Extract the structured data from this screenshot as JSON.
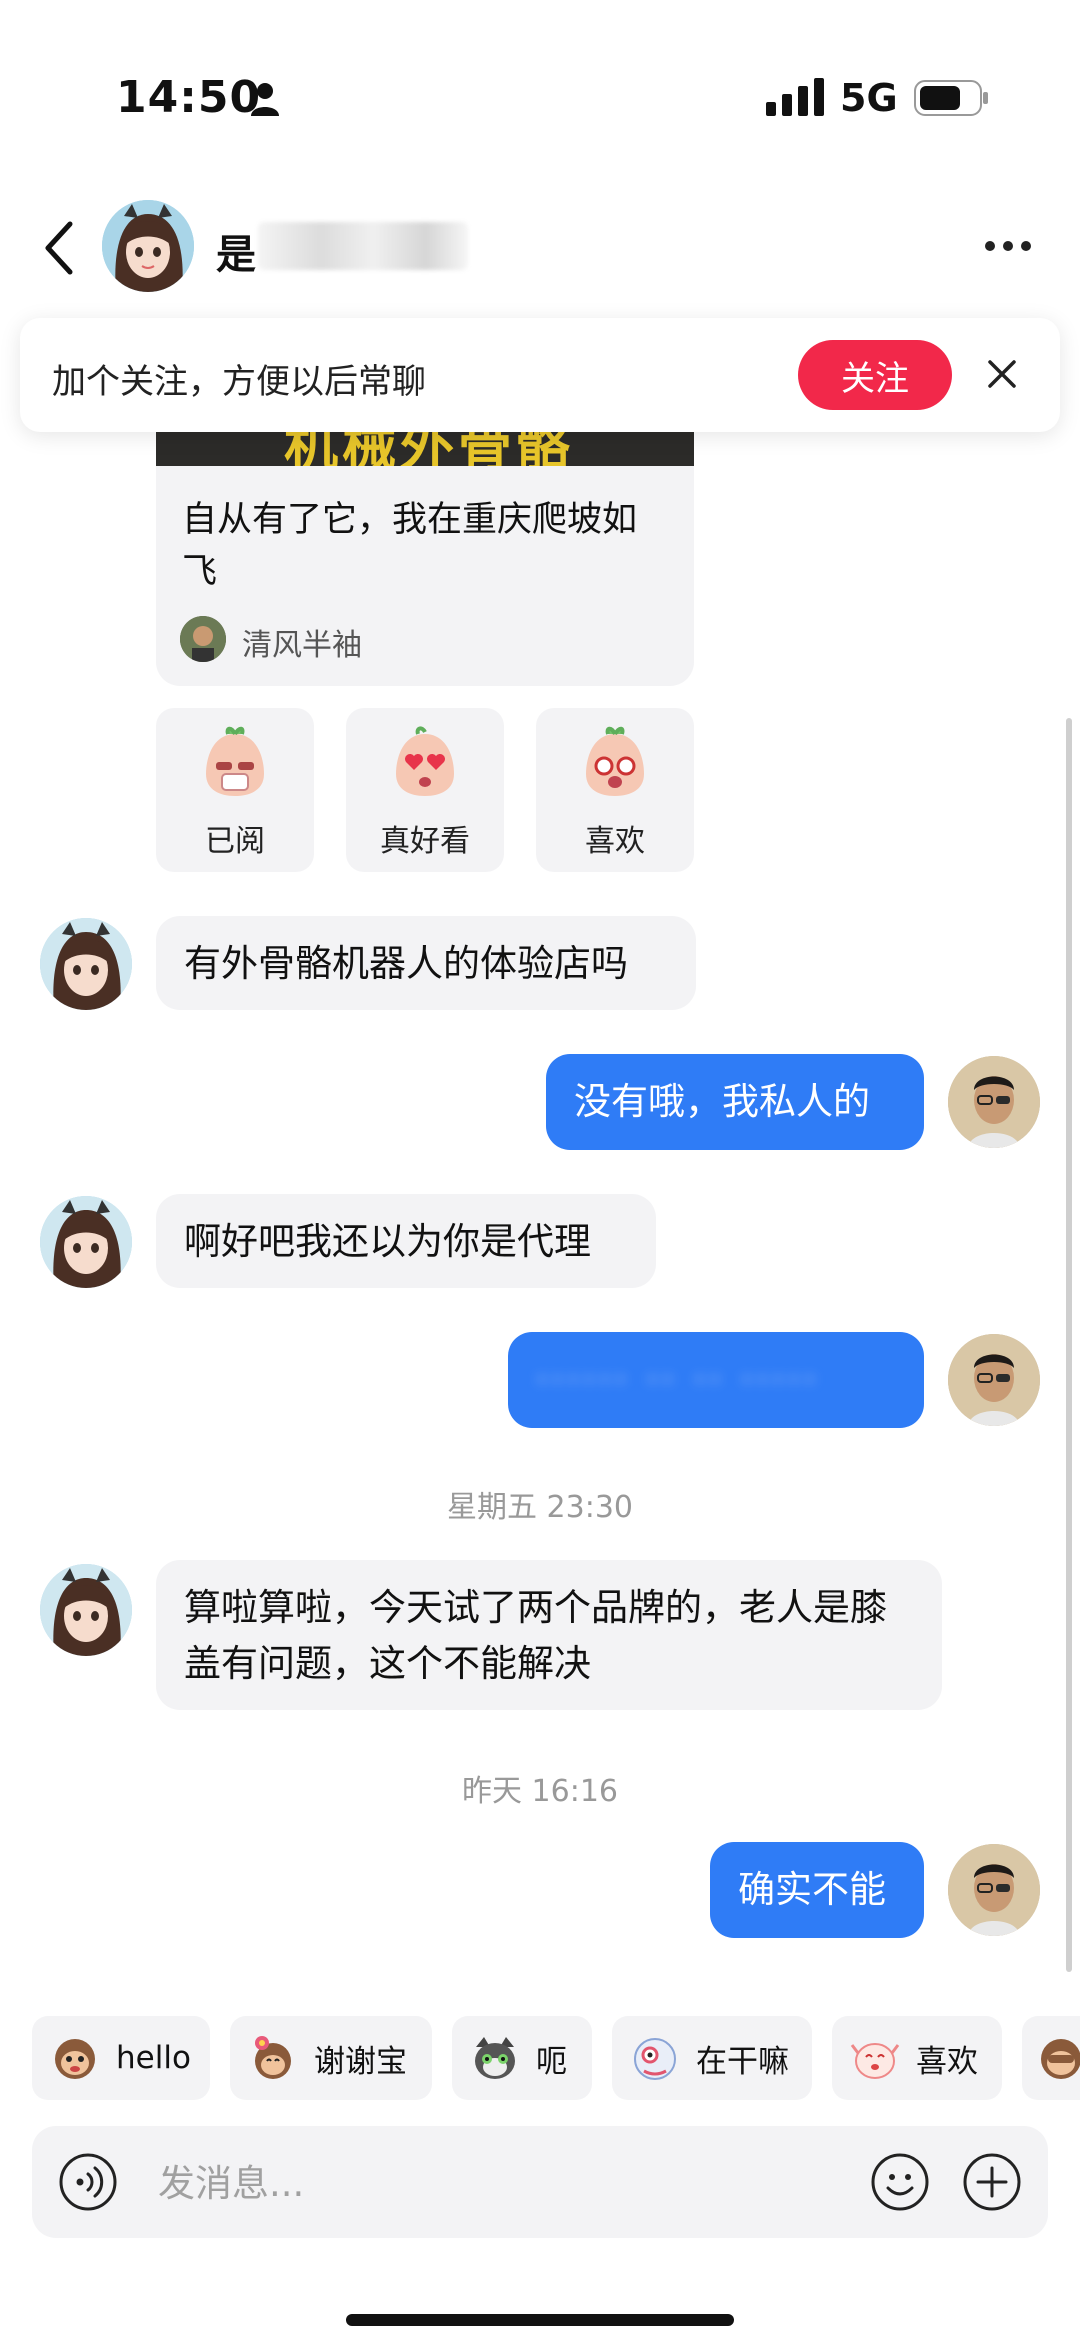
{
  "status_bar": {
    "time": "14:50",
    "network": "5G"
  },
  "header": {
    "contact_name_visible": "是",
    "contact_name_obscured": "有的宝宝"
  },
  "follow_banner": {
    "text": "加个关注，方便以后常聊",
    "button": "关注"
  },
  "shared_post": {
    "image_text": "机械外骨骼",
    "title": "自从有了它，我在重庆爬坡如飞",
    "author": "清风半袖"
  },
  "reactions": [
    {
      "label": "已阅",
      "icon": "read-sticker-icon"
    },
    {
      "label": "真好看",
      "icon": "heart-eyes-sticker-icon"
    },
    {
      "label": "喜欢",
      "icon": "love-sticker-icon"
    }
  ],
  "messages": [
    {
      "side": "left",
      "text": "有外骨骼机器人的体验店吗"
    },
    {
      "side": "right",
      "text": "没有哦，我私人的"
    },
    {
      "side": "left",
      "text": "啊好吧我还以为你是代理"
    },
    {
      "side": "right",
      "text": "······ ·· ·· ·····",
      "obscured": true
    },
    {
      "type": "timestamp",
      "text": "星期五 23:30"
    },
    {
      "side": "left",
      "text": "算啦算啦，今天试了两个品牌的，老人是膝盖有问题，这个不能解决"
    },
    {
      "type": "timestamp",
      "text": "昨天 16:16"
    },
    {
      "side": "right",
      "text": "确实不能"
    }
  ],
  "quick_replies": [
    {
      "label": "hello",
      "icon": "monkey-sticker-icon"
    },
    {
      "label": "谢谢宝",
      "icon": "monkey-flower-sticker-icon"
    },
    {
      "label": "呃",
      "icon": "cat-sticker-icon"
    },
    {
      "label": "在干嘛",
      "icon": "peek-sticker-icon"
    },
    {
      "label": "喜欢",
      "icon": "cheer-sticker-icon"
    }
  ],
  "input": {
    "placeholder": "发消息..."
  },
  "colors": {
    "accent_blue": "#2f7cf6",
    "follow_red": "#f2284a",
    "bubble_gray": "#f3f3f5"
  }
}
